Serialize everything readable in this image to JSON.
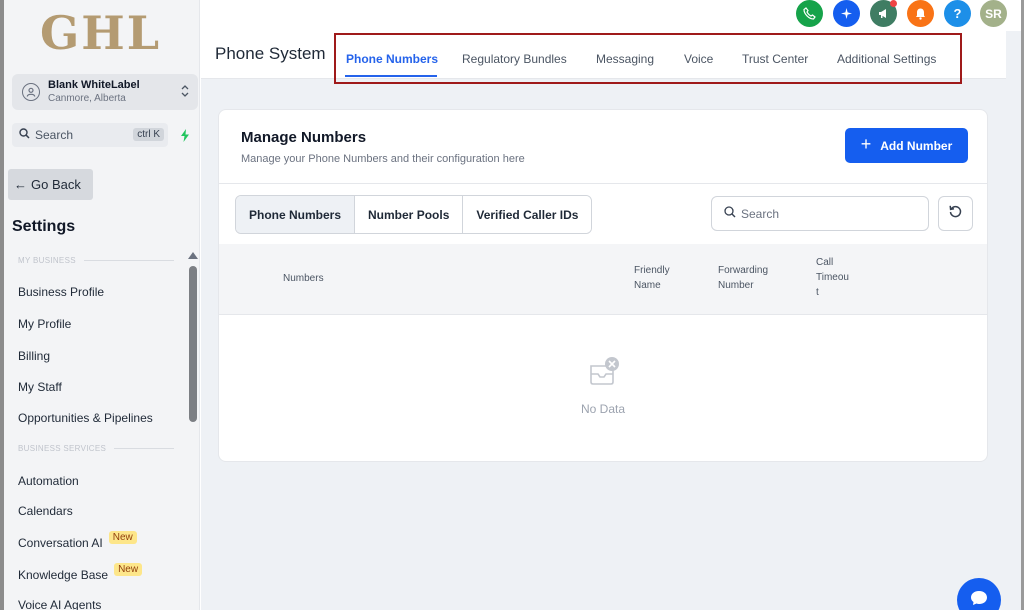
{
  "sidebar": {
    "logo": "GHL",
    "location": {
      "name": "Blank WhiteLabel",
      "city": "Canmore, Alberta"
    },
    "search": {
      "label": "Search",
      "shortcut": "ctrl K"
    },
    "go_back": "Go Back",
    "title": "Settings",
    "sections": [
      {
        "heading": "MY BUSINESS",
        "items": [
          "Business Profile",
          "My Profile",
          "Billing",
          "My Staff",
          "Opportunities & Pipelines"
        ]
      },
      {
        "heading": "BUSINESS SERVICES",
        "items": [
          "Automation",
          "Calendars",
          "Conversation AI",
          "Knowledge Base",
          "Voice AI Agents"
        ]
      }
    ],
    "new_badge": "New"
  },
  "topbar": {
    "icons": [
      {
        "name": "phone-icon",
        "color": "#16a34a"
      },
      {
        "name": "ai-sparkle-icon",
        "color": "#155eef"
      },
      {
        "name": "megaphone-icon",
        "color": "#3f7d63"
      },
      {
        "name": "bell-icon",
        "color": "#f97316"
      },
      {
        "name": "help-icon",
        "color": "#1d8fe8",
        "label": "?"
      }
    ],
    "avatar_initials": "SR",
    "avatar_color": "#a3b18a"
  },
  "header": {
    "title": "Phone System",
    "tabs": [
      "Phone Numbers",
      "Regulatory Bundles",
      "Messaging",
      "Voice",
      "Trust Center",
      "Additional Settings"
    ],
    "active_tab": "Phone Numbers"
  },
  "card": {
    "title": "Manage Numbers",
    "subtitle": "Manage your Phone Numbers and their configuration here",
    "add_button": "Add Number",
    "segments": [
      "Phone Numbers",
      "Number Pools",
      "Verified Caller IDs"
    ],
    "active_segment": "Phone Numbers",
    "search_placeholder": "Search",
    "columns": [
      {
        "lines": [
          "Numbers"
        ]
      },
      {
        "lines": [
          "Friendly",
          "Name"
        ]
      },
      {
        "lines": [
          "Forwarding",
          "Number"
        ]
      },
      {
        "lines": [
          "Call",
          "Timeou",
          "t"
        ]
      }
    ],
    "empty_text": "No Data"
  },
  "colors": {
    "accent": "#155eef",
    "highlight_border": "#9f1a1a",
    "logo": "#b49b72"
  }
}
